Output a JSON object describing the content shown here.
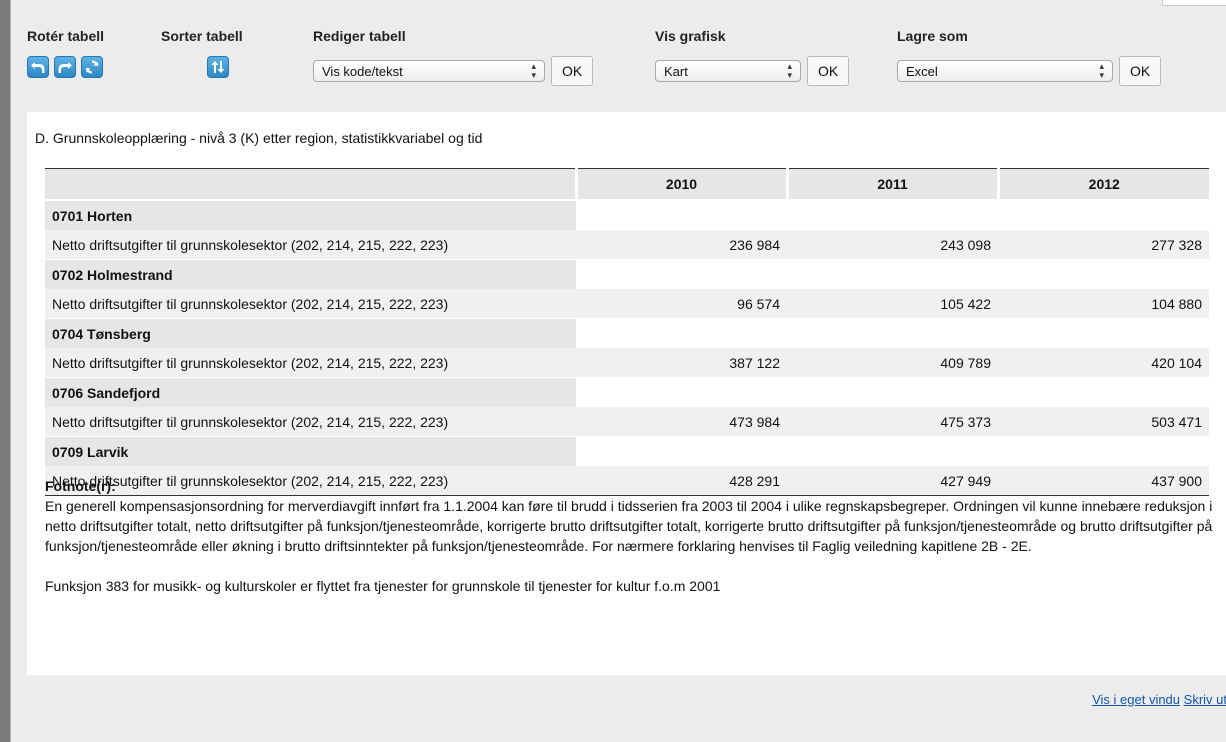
{
  "toolbar": {
    "rotate": {
      "label": "Rotér tabell",
      "icons": [
        "rotate-left-icon",
        "rotate-right-icon",
        "refresh-icon"
      ]
    },
    "sort": {
      "label": "Sorter tabell",
      "icons": [
        "sort-arrows-icon"
      ]
    },
    "edit": {
      "label": "Rediger tabell",
      "select_value": "Vis kode/tekst",
      "ok_label": "OK"
    },
    "graphic": {
      "label": "Vis grafisk",
      "select_value": "Kart",
      "ok_label": "OK"
    },
    "save": {
      "label": "Lagre som",
      "select_value": "Excel",
      "ok_label": "OK"
    }
  },
  "table": {
    "title": "D. Grunnskoleopplæring - nivå 3 (K) etter region, statistikkvariabel og tid",
    "years": [
      "2010",
      "2011",
      "2012"
    ],
    "variable_label": "Netto driftsutgifter til grunnskolesektor (202, 214, 215, 222, 223)",
    "rows": [
      {
        "region": "0701 Horten",
        "values": [
          "236 984",
          "243 098",
          "277 328"
        ]
      },
      {
        "region": "0702 Holmestrand",
        "values": [
          "96 574",
          "105 422",
          "104 880"
        ]
      },
      {
        "region": "0704 Tønsberg",
        "values": [
          "387 122",
          "409 789",
          "420 104"
        ]
      },
      {
        "region": "0706 Sandefjord",
        "values": [
          "473 984",
          "475 373",
          "503 471"
        ]
      },
      {
        "region": "0709 Larvik",
        "values": [
          "428 291",
          "427 949",
          "437 900"
        ]
      }
    ]
  },
  "footnote": {
    "heading": "Fotnote(r):",
    "paragraph1": "En generell kompensasjonsordning for merverdiavgift innført fra 1.1.2004 kan føre til brudd i tidsserien fra 2003 til 2004 i ulike regnskapsbegreper. Ordningen vil kunne innebære reduksjon i netto driftsutgifter totalt, netto driftsutgifter på funksjon/tjenesteområde, korrigerte brutto driftsutgifter totalt, korrigerte brutto driftsutgifter på funksjon/tjenesteområde og brutto driftsutgifter på funksjon/tjenesteområde eller økning i brutto driftsinntekter på funksjon/tjenesteområde. For nærmere forklaring henvises til Faglig veiledning kapitlene 2B - 2E.",
    "paragraph2": "Funksjon 383 for musikk- og kulturskoler er flyttet fra tjenester for grunnskole til tjenester for kultur f.o.m 2001"
  },
  "links": {
    "own_window": "Vis i eget vindu",
    "print": "Skriv ut"
  },
  "colors": {
    "icon_blue": "#2e87c4",
    "link_blue": "#1155aa",
    "header_gray": "#e6e6e6"
  }
}
